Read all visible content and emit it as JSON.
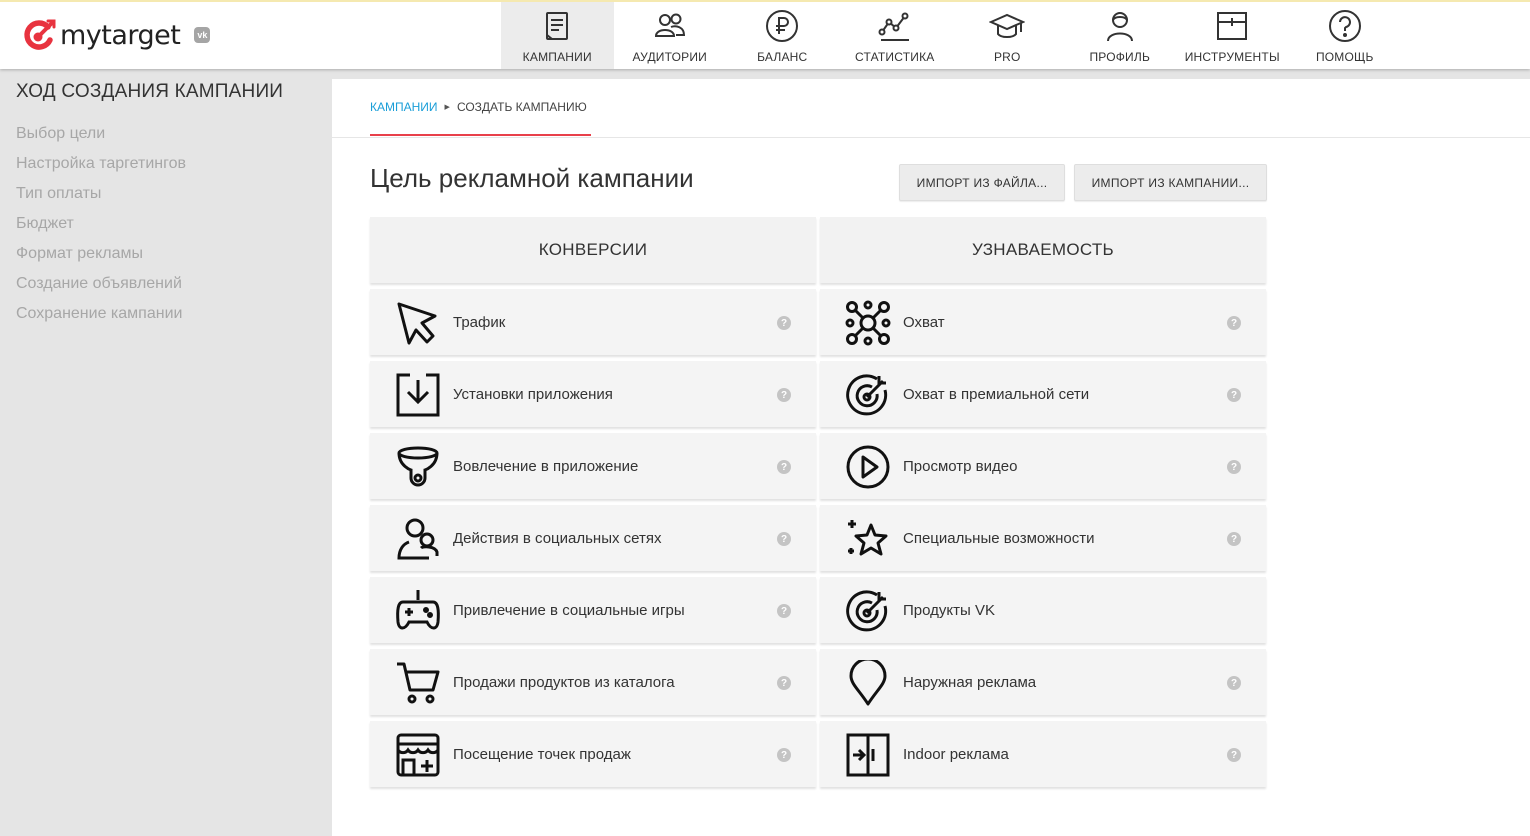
{
  "brand": {
    "logo_text": "mytarget",
    "badge": "vk"
  },
  "nav": [
    {
      "label": "КАМПАНИИ",
      "icon": "campaigns-icon"
    },
    {
      "label": "АУДИТОРИИ",
      "icon": "audiences-icon"
    },
    {
      "label": "БАЛАНС",
      "icon": "ruble-icon"
    },
    {
      "label": "СТАТИСТИКА",
      "icon": "statistics-icon"
    },
    {
      "label": "PRO",
      "icon": "graduation-cap-icon"
    },
    {
      "label": "ПРОФИЛЬ",
      "icon": "profile-icon"
    },
    {
      "label": "ИНСТРУМЕНТЫ",
      "icon": "tools-icon"
    },
    {
      "label": "ПОМОЩЬ",
      "icon": "help-icon"
    }
  ],
  "sidebar": {
    "title": "ХОД СОЗДАНИЯ КАМПАНИИ",
    "steps": [
      "Выбор цели",
      "Настройка таргетингов",
      "Тип оплаты",
      "Бюджет",
      "Формат рекламы",
      "Создание объявлений",
      "Сохранение кампании"
    ]
  },
  "breadcrumb": {
    "link": "КАМПАНИИ",
    "current": "СОЗДАТЬ КАМПАНИЮ"
  },
  "page": {
    "title": "Цель рекламной кампании",
    "import_file_button": "ИМПОРТ ИЗ ФАЙЛА...",
    "import_campaign_button": "ИМПОРТ ИЗ КАМПАНИИ..."
  },
  "columns": [
    {
      "title": "КОНВЕРСИИ",
      "goals": [
        {
          "label": "Трафик",
          "icon": "cursor-icon",
          "help": "?"
        },
        {
          "label": "Установки приложения",
          "icon": "download-box-icon",
          "help": "?"
        },
        {
          "label": "Вовлечение в приложение",
          "icon": "funnel-icon",
          "help": "?"
        },
        {
          "label": "Действия в социальных сетях",
          "icon": "social-people-icon",
          "help": "?"
        },
        {
          "label": "Привлечение в социальные игры",
          "icon": "gamepad-icon",
          "help": "?"
        },
        {
          "label": "Продажи продуктов из каталога",
          "icon": "cart-icon",
          "help": "?"
        },
        {
          "label": "Посещение точек продаж",
          "icon": "store-icon",
          "help": "?"
        }
      ]
    },
    {
      "title": "УЗНАВАЕМОСТЬ",
      "goals": [
        {
          "label": "Охват",
          "icon": "network-icon",
          "help": "?"
        },
        {
          "label": "Охват в премиальной сети",
          "icon": "target-icon",
          "help": "?"
        },
        {
          "label": "Просмотр видео",
          "icon": "play-icon",
          "help": "?"
        },
        {
          "label": "Специальные возможности",
          "icon": "star-icon",
          "help": "?"
        },
        {
          "label": "Продукты VK",
          "icon": "target-icon",
          "help": ""
        },
        {
          "label": "Наружная реклама",
          "icon": "map-pin-icon",
          "help": "?"
        },
        {
          "label": "Indoor реклама",
          "icon": "door-icon",
          "help": "?"
        }
      ]
    }
  ]
}
